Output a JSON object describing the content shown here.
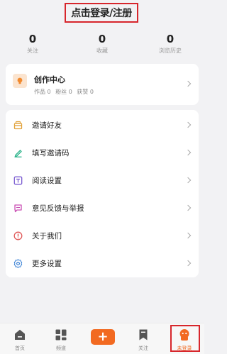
{
  "header": {
    "login_label": "点击登录/注册"
  },
  "stats": [
    {
      "value": "0",
      "label": "关注"
    },
    {
      "value": "0",
      "label": "收藏"
    },
    {
      "value": "0",
      "label": "浏览历史"
    }
  ],
  "creator": {
    "title": "创作中心",
    "works": "作品 0",
    "fans": "粉丝 0",
    "likes": "获赞 0"
  },
  "menu": {
    "items": [
      {
        "label": "邀请好友",
        "icon": "gift-icon"
      },
      {
        "label": "填写邀请码",
        "icon": "pen-icon"
      },
      {
        "label": "阅读设置",
        "icon": "text-icon"
      },
      {
        "label": "意见反馈与举报",
        "icon": "feedback-icon"
      },
      {
        "label": "关于我们",
        "icon": "info-icon"
      },
      {
        "label": "更多设置",
        "icon": "gear-icon"
      }
    ]
  },
  "tabbar": {
    "home": "首页",
    "channel": "频道",
    "add": "+",
    "follow": "关注",
    "me": "未登录"
  },
  "colors": {
    "accent": "#f26a21",
    "highlight_border": "#d7262c",
    "background": "#f2f2f4"
  }
}
